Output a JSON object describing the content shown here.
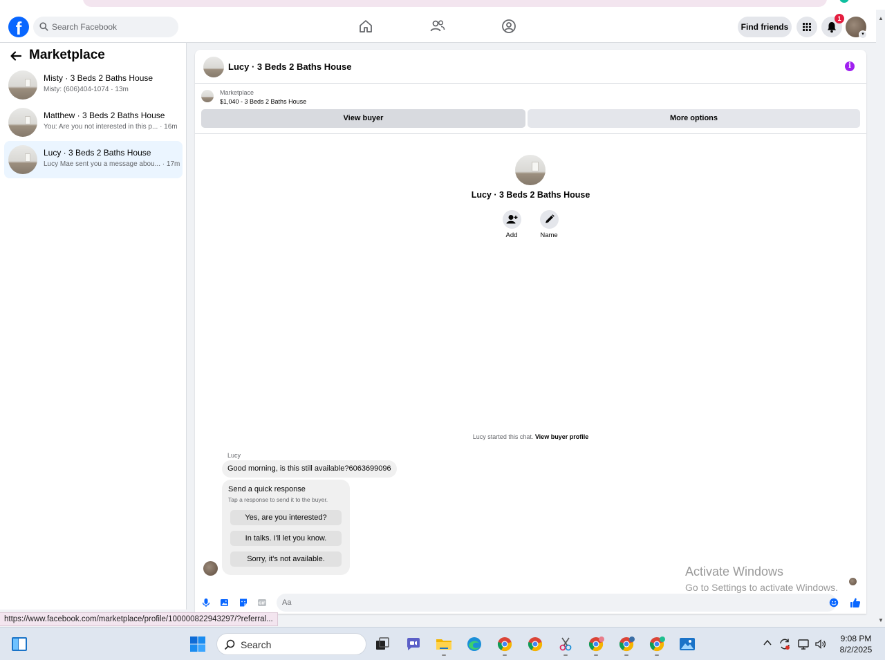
{
  "topbar": {
    "logo_letter": "f",
    "search_placeholder": "Search Facebook",
    "find_friends": "Find friends",
    "notification_count": "1"
  },
  "sidebar": {
    "title": "Marketplace",
    "items": [
      {
        "name": "Misty · 3 Beds 2 Baths House",
        "preview": "Misty: (606)404-1074 · 13m"
      },
      {
        "name": "Matthew · 3 Beds 2 Baths House",
        "preview": "You: Are you not interested in this p... · 16m"
      },
      {
        "name": "Lucy · 3 Beds 2 Baths House",
        "preview": "Lucy Mae sent you a message abou... · 17m"
      }
    ]
  },
  "chat": {
    "title": "Lucy · 3 Beds 2 Baths House",
    "marketplace_label": "Marketplace",
    "item_line": "$1,040 - 3 Beds 2 Baths House",
    "view_buyer": "View buyer",
    "more_options": "More options",
    "center_name": "Lucy · 3 Beds 2 Baths House",
    "add_label": "Add",
    "name_label": "Name",
    "started_text": "Lucy started this chat. ",
    "view_buyer_profile": "View buyer profile",
    "sender": "Lucy",
    "message": "Good morning, is this still available?6063699096",
    "quick_title": "Send a quick response",
    "quick_sub": "Tap a response to send it to the buyer.",
    "quick_responses": [
      "Yes, are you interested?",
      "In talks. I'll let you know.",
      "Sorry, it's not available."
    ],
    "composer_placeholder": "Aa"
  },
  "watermark": {
    "line1": "Activate Windows",
    "line2": "Go to Settings to activate Windows."
  },
  "status_url": "https://www.facebook.com/marketplace/profile/100000822943297/?referral...",
  "taskbar": {
    "search_label": "Search",
    "time": "9:08 PM",
    "date": "8/2/2025"
  },
  "colors": {
    "fb_blue": "#0866ff",
    "info_purple": "#a020f0",
    "active_item_bg": "#ebf5ff",
    "badge_red": "#e41e3f"
  }
}
